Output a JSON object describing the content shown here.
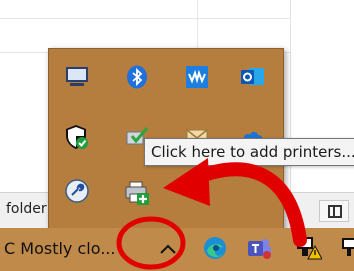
{
  "background": {
    "folder_label": "folder"
  },
  "tray_flyout": {
    "icons": [
      {
        "name": "display-monitor-icon"
      },
      {
        "name": "bluetooth-icon"
      },
      {
        "name": "audio-waveform-app-icon"
      },
      {
        "name": "outlook-icon"
      },
      {
        "name": "windows-security-shield-icon"
      },
      {
        "name": "sync-check-icon"
      },
      {
        "name": "mail-envelope-icon"
      },
      {
        "name": "cloud-icon"
      },
      {
        "name": "remote-support-icon"
      },
      {
        "name": "add-printer-icon"
      }
    ]
  },
  "tooltip": {
    "text": "Click here to add printers..."
  },
  "taskbar": {
    "weather_text": "C  Mostly clo...",
    "chevron_label": "^",
    "icons": [
      {
        "name": "edge-browser-icon"
      },
      {
        "name": "teams-icon"
      },
      {
        "name": "network-warning-icon"
      },
      {
        "name": "network-icon"
      }
    ]
  },
  "colors": {
    "taskbar": "#c08a4a",
    "flyout": "#b57e3e",
    "annotation_red": "#e00000"
  }
}
